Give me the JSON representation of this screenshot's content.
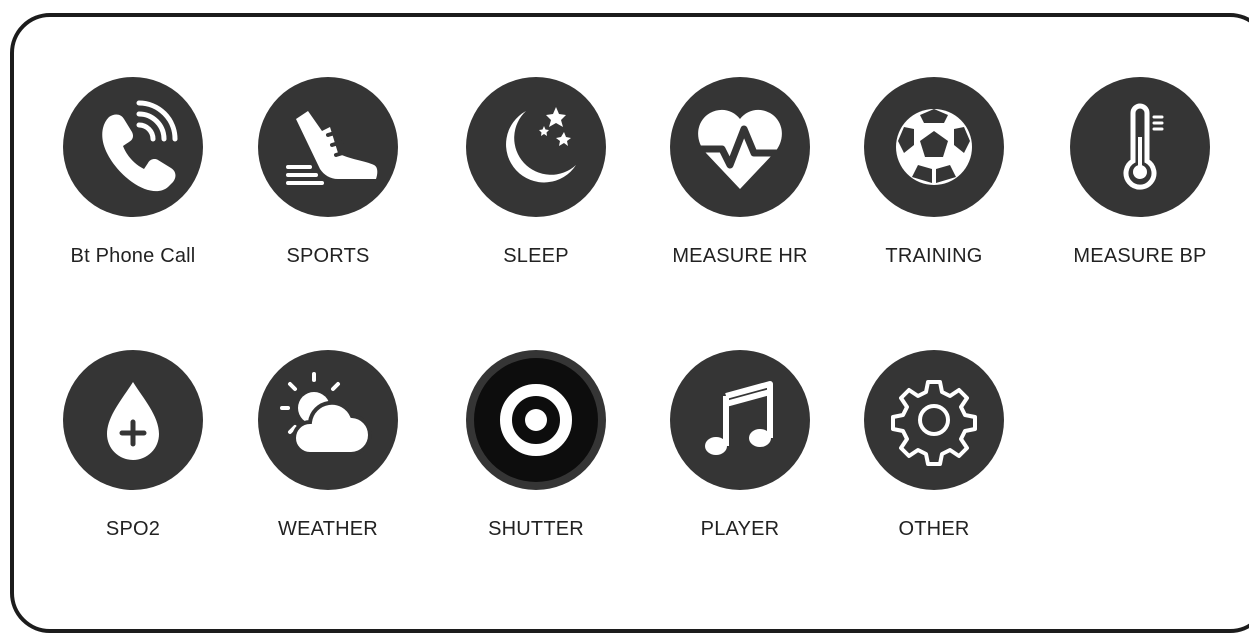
{
  "colors": {
    "icon_bg": "#353535",
    "frame": "#1c1c1c",
    "icon_fg": "#ffffff",
    "shutter_ring": "#0d0d0d"
  },
  "items": [
    {
      "label": "Bt Phone Call",
      "icon": "phone-call-icon"
    },
    {
      "label": "SPORTS",
      "icon": "running-shoe-icon"
    },
    {
      "label": "SLEEP",
      "icon": "moon-stars-icon"
    },
    {
      "label": "MEASURE HR",
      "icon": "heart-rate-icon"
    },
    {
      "label": "TRAINING",
      "icon": "soccer-ball-icon"
    },
    {
      "label": "MEASURE BP",
      "icon": "thermometer-icon"
    },
    {
      "label": "SPO2",
      "icon": "blood-drop-plus-icon"
    },
    {
      "label": "WEATHER",
      "icon": "sun-cloud-icon"
    },
    {
      "label": "SHUTTER",
      "icon": "shutter-target-icon"
    },
    {
      "label": "PLAYER",
      "icon": "music-note-icon"
    },
    {
      "label": "OTHER",
      "icon": "gear-icon"
    }
  ]
}
